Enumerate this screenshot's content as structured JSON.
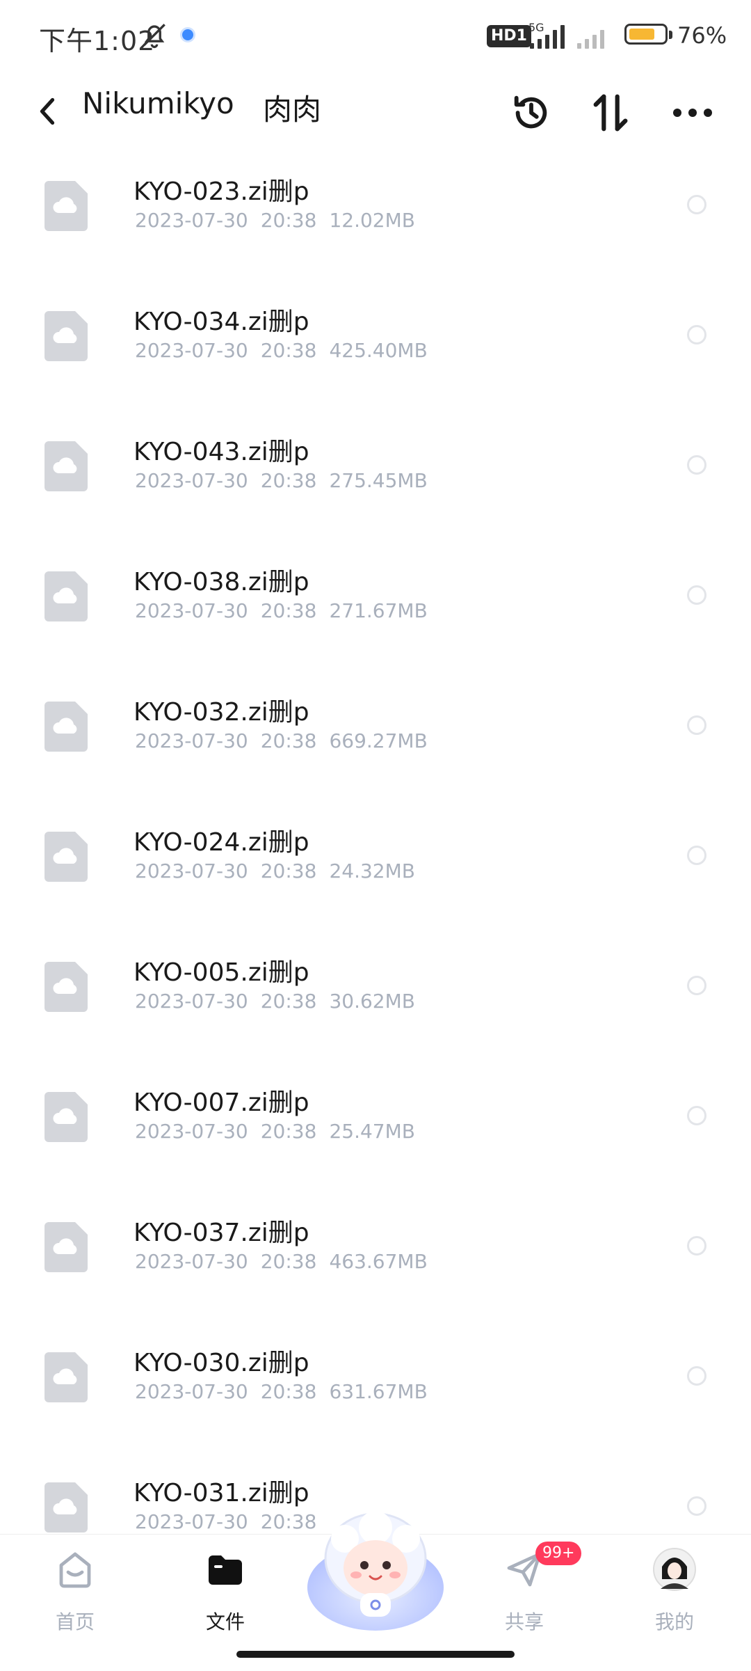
{
  "status_bar": {
    "time": "下午1:02",
    "network_badge": "HD1",
    "network_type": "5G",
    "battery_percent": "76%",
    "battery_level": 0.76,
    "battery_color": "#f7b733"
  },
  "header": {
    "title": "Nikumikyo",
    "subtitle": "肉肉",
    "icons": [
      "back-arrow-icon",
      "history-icon",
      "sort-icon",
      "more-icon"
    ]
  },
  "files": [
    {
      "name": "KYO-023.zi删p",
      "date": "2023-07-30",
      "time": "20:38",
      "size": "12.02MB"
    },
    {
      "name": "KYO-034.zi删p",
      "date": "2023-07-30",
      "time": "20:38",
      "size": "425.40MB"
    },
    {
      "name": "KYO-043.zi删p",
      "date": "2023-07-30",
      "time": "20:38",
      "size": "275.45MB"
    },
    {
      "name": "KYO-038.zi删p",
      "date": "2023-07-30",
      "time": "20:38",
      "size": "271.67MB"
    },
    {
      "name": "KYO-032.zi删p",
      "date": "2023-07-30",
      "time": "20:38",
      "size": "669.27MB"
    },
    {
      "name": "KYO-024.zi删p",
      "date": "2023-07-30",
      "time": "20:38",
      "size": "24.32MB"
    },
    {
      "name": "KYO-005.zi删p",
      "date": "2023-07-30",
      "time": "20:38",
      "size": "30.62MB"
    },
    {
      "name": "KYO-007.zi删p",
      "date": "2023-07-30",
      "time": "20:38",
      "size": "25.47MB"
    },
    {
      "name": "KYO-037.zi删p",
      "date": "2023-07-30",
      "time": "20:38",
      "size": "463.67MB"
    },
    {
      "name": "KYO-030.zi删p",
      "date": "2023-07-30",
      "time": "20:38",
      "size": "631.67MB"
    },
    {
      "name": "KYO-031.zi删p",
      "date": "2023-07-30",
      "time": "20:38",
      "size": ""
    }
  ],
  "bottom_nav": {
    "items": [
      {
        "label": "首页",
        "icon": "home-icon"
      },
      {
        "label": "文件",
        "icon": "folder-icon",
        "active": true
      },
      {
        "label": "",
        "icon": "mascot-icon"
      },
      {
        "label": "共享",
        "icon": "share-icon",
        "badge": "99+"
      },
      {
        "label": "我的",
        "icon": "avatar"
      }
    ]
  },
  "colors": {
    "text_primary": "#1a1a1a",
    "text_secondary": "#a9b0bc",
    "badge": "#ff3a5c"
  }
}
